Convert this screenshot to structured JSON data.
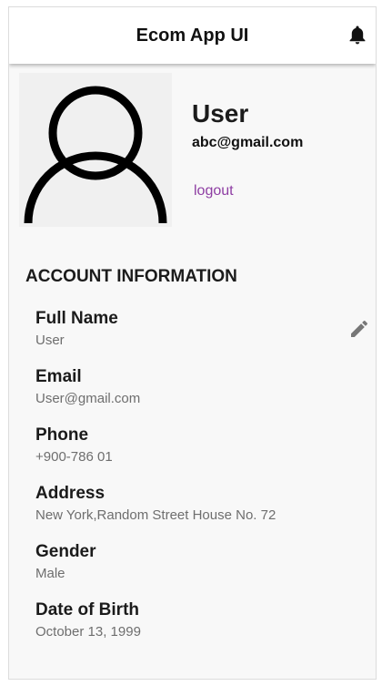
{
  "appbar": {
    "title": "Ecom App UI",
    "notification_icon": "bell-icon"
  },
  "profile": {
    "avatar_icon": "person-outline-icon",
    "name": "User",
    "email": "abc@gmail.com",
    "logout_label": "logout"
  },
  "account": {
    "heading": "ACCOUNT INFORMATION",
    "edit_icon": "pencil-icon",
    "fields": [
      {
        "label": "Full Name",
        "value": "User"
      },
      {
        "label": "Email",
        "value": "User@gmail.com"
      },
      {
        "label": "Phone",
        "value": "+900-786 01"
      },
      {
        "label": "Address",
        "value": "New York,Random Street House No. 72"
      },
      {
        "label": "Gender",
        "value": "Male"
      },
      {
        "label": "Date of Birth",
        "value": "October 13, 1999"
      }
    ]
  },
  "colors": {
    "link": "#8e3ea3",
    "background": "#f8f8f8",
    "appbar": "#ffffff",
    "value_text": "#6e6e6e"
  }
}
